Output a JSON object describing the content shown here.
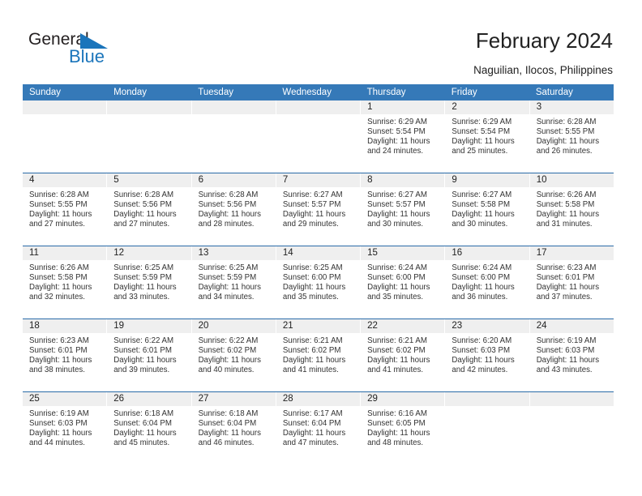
{
  "brand": {
    "name_part1": "General",
    "name_part2": "Blue",
    "triangle_color": "#1b75bb",
    "text_color": "#231f20"
  },
  "header": {
    "title": "February 2024",
    "subtitle": "Naguilian, Ilocos, Philippines"
  },
  "theme": {
    "header_bg": "#3579b8",
    "header_text": "#ffffff",
    "row_divider": "#2a6ba8",
    "daynum_band": "#efefef",
    "cell_bg": "#ffffff",
    "body_text": "#333333"
  },
  "weekday_headers": [
    "Sunday",
    "Monday",
    "Tuesday",
    "Wednesday",
    "Thursday",
    "Friday",
    "Saturday"
  ],
  "weeks": [
    [
      {
        "day": "",
        "sunrise": "",
        "sunset": "",
        "daylight1": "",
        "daylight2": "",
        "empty": true
      },
      {
        "day": "",
        "sunrise": "",
        "sunset": "",
        "daylight1": "",
        "daylight2": "",
        "empty": true
      },
      {
        "day": "",
        "sunrise": "",
        "sunset": "",
        "daylight1": "",
        "daylight2": "",
        "empty": true
      },
      {
        "day": "",
        "sunrise": "",
        "sunset": "",
        "daylight1": "",
        "daylight2": "",
        "empty": true
      },
      {
        "day": "1",
        "sunrise": "Sunrise: 6:29 AM",
        "sunset": "Sunset: 5:54 PM",
        "daylight1": "Daylight: 11 hours",
        "daylight2": "and 24 minutes.",
        "empty": false
      },
      {
        "day": "2",
        "sunrise": "Sunrise: 6:29 AM",
        "sunset": "Sunset: 5:54 PM",
        "daylight1": "Daylight: 11 hours",
        "daylight2": "and 25 minutes.",
        "empty": false
      },
      {
        "day": "3",
        "sunrise": "Sunrise: 6:28 AM",
        "sunset": "Sunset: 5:55 PM",
        "daylight1": "Daylight: 11 hours",
        "daylight2": "and 26 minutes.",
        "empty": false
      }
    ],
    [
      {
        "day": "4",
        "sunrise": "Sunrise: 6:28 AM",
        "sunset": "Sunset: 5:55 PM",
        "daylight1": "Daylight: 11 hours",
        "daylight2": "and 27 minutes.",
        "empty": false
      },
      {
        "day": "5",
        "sunrise": "Sunrise: 6:28 AM",
        "sunset": "Sunset: 5:56 PM",
        "daylight1": "Daylight: 11 hours",
        "daylight2": "and 27 minutes.",
        "empty": false
      },
      {
        "day": "6",
        "sunrise": "Sunrise: 6:28 AM",
        "sunset": "Sunset: 5:56 PM",
        "daylight1": "Daylight: 11 hours",
        "daylight2": "and 28 minutes.",
        "empty": false
      },
      {
        "day": "7",
        "sunrise": "Sunrise: 6:27 AM",
        "sunset": "Sunset: 5:57 PM",
        "daylight1": "Daylight: 11 hours",
        "daylight2": "and 29 minutes.",
        "empty": false
      },
      {
        "day": "8",
        "sunrise": "Sunrise: 6:27 AM",
        "sunset": "Sunset: 5:57 PM",
        "daylight1": "Daylight: 11 hours",
        "daylight2": "and 30 minutes.",
        "empty": false
      },
      {
        "day": "9",
        "sunrise": "Sunrise: 6:27 AM",
        "sunset": "Sunset: 5:58 PM",
        "daylight1": "Daylight: 11 hours",
        "daylight2": "and 30 minutes.",
        "empty": false
      },
      {
        "day": "10",
        "sunrise": "Sunrise: 6:26 AM",
        "sunset": "Sunset: 5:58 PM",
        "daylight1": "Daylight: 11 hours",
        "daylight2": "and 31 minutes.",
        "empty": false
      }
    ],
    [
      {
        "day": "11",
        "sunrise": "Sunrise: 6:26 AM",
        "sunset": "Sunset: 5:58 PM",
        "daylight1": "Daylight: 11 hours",
        "daylight2": "and 32 minutes.",
        "empty": false
      },
      {
        "day": "12",
        "sunrise": "Sunrise: 6:25 AM",
        "sunset": "Sunset: 5:59 PM",
        "daylight1": "Daylight: 11 hours",
        "daylight2": "and 33 minutes.",
        "empty": false
      },
      {
        "day": "13",
        "sunrise": "Sunrise: 6:25 AM",
        "sunset": "Sunset: 5:59 PM",
        "daylight1": "Daylight: 11 hours",
        "daylight2": "and 34 minutes.",
        "empty": false
      },
      {
        "day": "14",
        "sunrise": "Sunrise: 6:25 AM",
        "sunset": "Sunset: 6:00 PM",
        "daylight1": "Daylight: 11 hours",
        "daylight2": "and 35 minutes.",
        "empty": false
      },
      {
        "day": "15",
        "sunrise": "Sunrise: 6:24 AM",
        "sunset": "Sunset: 6:00 PM",
        "daylight1": "Daylight: 11 hours",
        "daylight2": "and 35 minutes.",
        "empty": false
      },
      {
        "day": "16",
        "sunrise": "Sunrise: 6:24 AM",
        "sunset": "Sunset: 6:00 PM",
        "daylight1": "Daylight: 11 hours",
        "daylight2": "and 36 minutes.",
        "empty": false
      },
      {
        "day": "17",
        "sunrise": "Sunrise: 6:23 AM",
        "sunset": "Sunset: 6:01 PM",
        "daylight1": "Daylight: 11 hours",
        "daylight2": "and 37 minutes.",
        "empty": false
      }
    ],
    [
      {
        "day": "18",
        "sunrise": "Sunrise: 6:23 AM",
        "sunset": "Sunset: 6:01 PM",
        "daylight1": "Daylight: 11 hours",
        "daylight2": "and 38 minutes.",
        "empty": false
      },
      {
        "day": "19",
        "sunrise": "Sunrise: 6:22 AM",
        "sunset": "Sunset: 6:01 PM",
        "daylight1": "Daylight: 11 hours",
        "daylight2": "and 39 minutes.",
        "empty": false
      },
      {
        "day": "20",
        "sunrise": "Sunrise: 6:22 AM",
        "sunset": "Sunset: 6:02 PM",
        "daylight1": "Daylight: 11 hours",
        "daylight2": "and 40 minutes.",
        "empty": false
      },
      {
        "day": "21",
        "sunrise": "Sunrise: 6:21 AM",
        "sunset": "Sunset: 6:02 PM",
        "daylight1": "Daylight: 11 hours",
        "daylight2": "and 41 minutes.",
        "empty": false
      },
      {
        "day": "22",
        "sunrise": "Sunrise: 6:21 AM",
        "sunset": "Sunset: 6:02 PM",
        "daylight1": "Daylight: 11 hours",
        "daylight2": "and 41 minutes.",
        "empty": false
      },
      {
        "day": "23",
        "sunrise": "Sunrise: 6:20 AM",
        "sunset": "Sunset: 6:03 PM",
        "daylight1": "Daylight: 11 hours",
        "daylight2": "and 42 minutes.",
        "empty": false
      },
      {
        "day": "24",
        "sunrise": "Sunrise: 6:19 AM",
        "sunset": "Sunset: 6:03 PM",
        "daylight1": "Daylight: 11 hours",
        "daylight2": "and 43 minutes.",
        "empty": false
      }
    ],
    [
      {
        "day": "25",
        "sunrise": "Sunrise: 6:19 AM",
        "sunset": "Sunset: 6:03 PM",
        "daylight1": "Daylight: 11 hours",
        "daylight2": "and 44 minutes.",
        "empty": false
      },
      {
        "day": "26",
        "sunrise": "Sunrise: 6:18 AM",
        "sunset": "Sunset: 6:04 PM",
        "daylight1": "Daylight: 11 hours",
        "daylight2": "and 45 minutes.",
        "empty": false
      },
      {
        "day": "27",
        "sunrise": "Sunrise: 6:18 AM",
        "sunset": "Sunset: 6:04 PM",
        "daylight1": "Daylight: 11 hours",
        "daylight2": "and 46 minutes.",
        "empty": false
      },
      {
        "day": "28",
        "sunrise": "Sunrise: 6:17 AM",
        "sunset": "Sunset: 6:04 PM",
        "daylight1": "Daylight: 11 hours",
        "daylight2": "and 47 minutes.",
        "empty": false
      },
      {
        "day": "29",
        "sunrise": "Sunrise: 6:16 AM",
        "sunset": "Sunset: 6:05 PM",
        "daylight1": "Daylight: 11 hours",
        "daylight2": "and 48 minutes.",
        "empty": false
      },
      {
        "day": "",
        "sunrise": "",
        "sunset": "",
        "daylight1": "",
        "daylight2": "",
        "empty": true
      },
      {
        "day": "",
        "sunrise": "",
        "sunset": "",
        "daylight1": "",
        "daylight2": "",
        "empty": true
      }
    ]
  ]
}
